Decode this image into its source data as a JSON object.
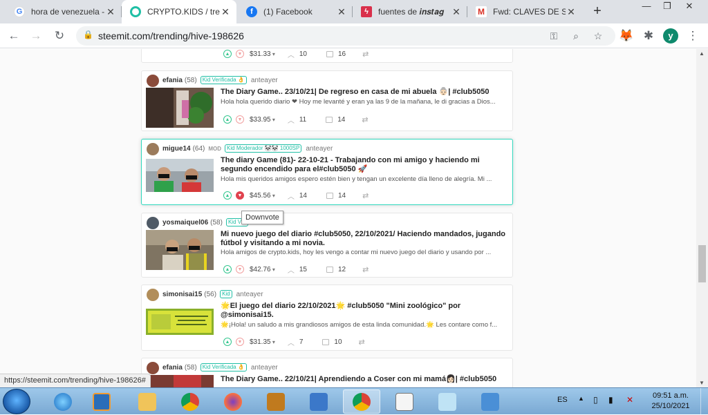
{
  "browser": {
    "tabs": [
      {
        "title": "hora de venezuela -",
        "icon": "google-icon",
        "active": false
      },
      {
        "title": "CRYPTO.KIDS / tren",
        "icon": "steemit-icon",
        "active": true
      },
      {
        "title": "(1) Facebook",
        "icon": "facebook-icon",
        "active": false
      },
      {
        "title": "fuentes de 𝒊𝒏𝒔𝒕𝒂𝒈",
        "icon": "fonts-site-icon",
        "active": false
      },
      {
        "title": "Fwd: CLAVES DE ST",
        "icon": "gmail-icon",
        "active": false
      }
    ],
    "url": "steemit.com/trending/hive-198626",
    "profile_initial": "y"
  },
  "posts": [
    {
      "payout": "$31.33",
      "votes": "10",
      "comments": "16"
    },
    {
      "author": "efania",
      "rep": "(58)",
      "mod": "",
      "badge": "Kid Verificada 👌",
      "time": "anteayer",
      "title": "The Diary Game.. 23/10/21| De regreso en casa de mi abuela 👵🏻| #club5050",
      "excerpt": "Hola hola querido diario ❤ Hoy me levanté y eran ya las 9 de la mañana, le di gracias a Dios...",
      "payout": "$33.95",
      "votes": "11",
      "comments": "14"
    },
    {
      "author": "migue14",
      "rep": "(64)",
      "mod": "MOD",
      "badge": "Kid Moderador 🐼🐼 1000SP",
      "time": "anteayer",
      "title": "The diary Game (81)- 22-10-21 - Trabajando con mi amigo y haciendo mi segundo encendido para el#club5050 🚀",
      "excerpt": "Hola mis queridos amigos espero estén bien y tengan un excelente día lleno de alegría. Mi ...",
      "payout": "$45.56",
      "votes": "14",
      "comments": "14"
    },
    {
      "author": "yosmaiquel06",
      "rep": "(58)",
      "mod": "",
      "badge": "Kid Ver",
      "time": "ier",
      "title": "Mi nuevo juego del diario #club5050, 22/10/2021/ Haciendo mandados, jugando fútbol y visitando a mi novia.",
      "excerpt": "Hola amigos de crypto.kids, hoy les vengo a contar mi nuevo juego del diario y usando por ...",
      "payout": "$42.76",
      "votes": "15",
      "comments": "12"
    },
    {
      "author": "simonisai15",
      "rep": "(56)",
      "mod": "",
      "badge": "Kid",
      "time": "anteayer",
      "title": "🌟El juego del diario 22/10/2021🌟 #club5050 \"Mini zoológico\" por @simonisai15.",
      "excerpt": "🌟¡Hola! un saludo a mis grandiosos amigos de esta linda comunidad.🌟 Les contare como f...",
      "payout": "$31.35",
      "votes": "7",
      "comments": "10"
    },
    {
      "author": "efania",
      "rep": "(58)",
      "mod": "",
      "badge": "Kid Verificada 👌",
      "time": "anteayer",
      "title": "The Diary Game.. 22/10/21| Aprendiendo a Coser con mi mamá👩🏻| #club5050"
    }
  ],
  "tooltip": "Downvote",
  "status_url": "https://steemit.com/trending/hive-198626#",
  "taskbar": {
    "lang": "ES",
    "time": "09:51 a.m.",
    "date": "25/10/2021"
  },
  "colors": {
    "accent": "#1fbfa5",
    "downvote_active": "#e0434f",
    "upvote": "#32c68e"
  }
}
